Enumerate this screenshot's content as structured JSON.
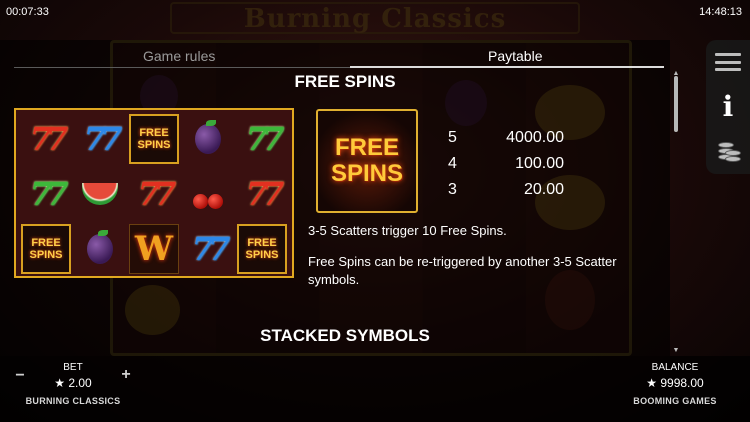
{
  "status": {
    "elapsed": "00:07:33",
    "time": "14:48:13"
  },
  "game": {
    "title": "Burning Classics"
  },
  "tabs": [
    {
      "label": "Game rules",
      "active": false
    },
    {
      "label": "Paytable",
      "active": true
    }
  ],
  "free_spins": {
    "title": "FREE SPINS",
    "symbol_text": [
      "FREE",
      "SPINS"
    ],
    "paytable": [
      {
        "count": "5",
        "amount": "4000.00"
      },
      {
        "count": "4",
        "amount": "100.00"
      },
      {
        "count": "3",
        "amount": "20.00"
      }
    ],
    "description_1": "3-5 Scatters trigger 10 Free Spins.",
    "description_2": "Free Spins can be re-triggered by another 3-5 Scatter symbols."
  },
  "preview_grid": {
    "rows": [
      [
        "seven-red",
        "seven-blue",
        "free-spins",
        "plum",
        "seven-green"
      ],
      [
        "seven-green",
        "watermelon",
        "seven-red",
        "cherry",
        "seven-red"
      ],
      [
        "free-spins",
        "plum",
        "wild",
        "seven-blue",
        "free-spins"
      ]
    ],
    "badge_text": [
      "FREE",
      "SPINS"
    ],
    "wild_text": "W",
    "seven_text": "77"
  },
  "next_section": {
    "title": "STACKED SYMBOLS"
  },
  "side_menu": [
    {
      "icon": "menu-icon"
    },
    {
      "icon": "info-icon",
      "glyph": "i"
    },
    {
      "icon": "coins-icon"
    }
  ],
  "bottom": {
    "bet_label": "BET",
    "bet_value": "★ 2.00",
    "minus": "−",
    "plus": "+",
    "game_name": "BURNING CLASSICS",
    "balance_label": "BALANCE",
    "balance_value": "★ 9998.00",
    "provider": "BOOMING GAMES"
  },
  "colors": {
    "gold_border": "#e0b030",
    "flame": "#ffca3a"
  }
}
